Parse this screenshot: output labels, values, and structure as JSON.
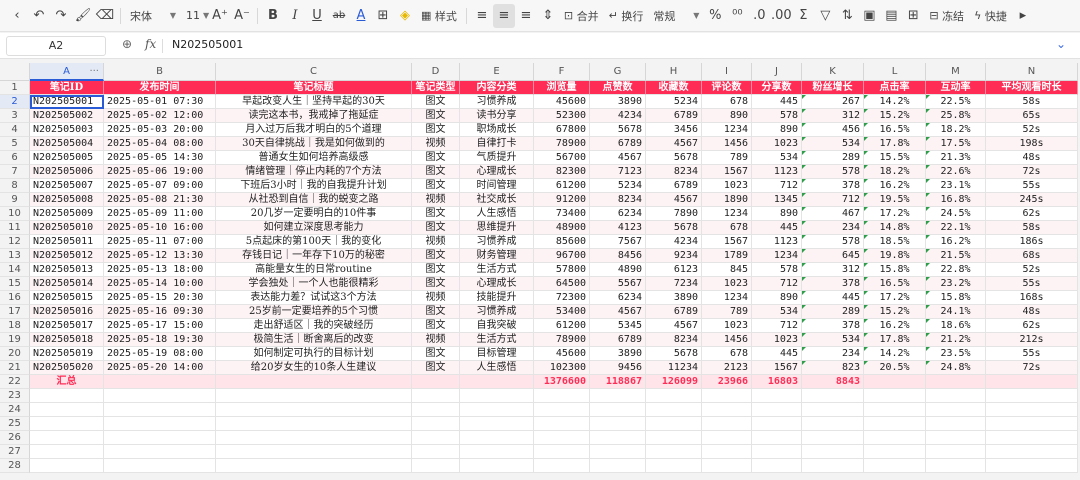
{
  "toolbar": {
    "font_name": "宋体",
    "font_size": "11",
    "bold": "B",
    "italic": "I",
    "underline": "U",
    "strike": "ab",
    "font_color": "A",
    "grow_font": "A⁺",
    "shrink_font": "A⁻",
    "style_label": "样式",
    "merge_label": "合并",
    "wrap_label": "换行",
    "number_format": "常规",
    "freeze_label": "冻结",
    "quick_label": "快捷"
  },
  "formula_bar": {
    "cell_ref": "A2",
    "fx": "fx",
    "value": "N202505001"
  },
  "columns": [
    "A",
    "B",
    "C",
    "D",
    "E",
    "F",
    "G",
    "H",
    "I",
    "J",
    "K",
    "L",
    "M",
    "N"
  ],
  "header_row": [
    "笔记ID",
    "发布时间",
    "笔记标题",
    "笔记类型",
    "内容分类",
    "浏览量",
    "点赞数",
    "收藏数",
    "评论数",
    "分享数",
    "粉丝增长",
    "点击率",
    "互动率",
    "平均观看时长"
  ],
  "rows": [
    [
      "N202505001",
      "2025-05-01 07:30",
      "早起改变人生｜坚持早起的30天",
      "图文",
      "习惯养成",
      "45600",
      "3890",
      "5234",
      "678",
      "445",
      "267",
      "14.2%",
      "22.5%",
      "58s"
    ],
    [
      "N202505002",
      "2025-05-02 12:00",
      "读完这本书，我戒掉了拖延症",
      "图文",
      "读书分享",
      "52300",
      "4234",
      "6789",
      "890",
      "578",
      "312",
      "15.2%",
      "25.8%",
      "65s"
    ],
    [
      "N202505003",
      "2025-05-03 20:00",
      "月入过万后我才明白的5个道理",
      "图文",
      "职场成长",
      "67800",
      "5678",
      "3456",
      "1234",
      "890",
      "456",
      "16.5%",
      "18.2%",
      "52s"
    ],
    [
      "N202505004",
      "2025-05-04 08:00",
      "30天自律挑战｜我是如何做到的",
      "视频",
      "自律打卡",
      "78900",
      "6789",
      "4567",
      "1456",
      "1023",
      "534",
      "17.8%",
      "17.5%",
      "198s"
    ],
    [
      "N202505005",
      "2025-05-05 14:30",
      "普通女生如何培养高级感",
      "图文",
      "气质提升",
      "56700",
      "4567",
      "5678",
      "789",
      "534",
      "289",
      "15.5%",
      "21.3%",
      "48s"
    ],
    [
      "N202505006",
      "2025-05-06 19:00",
      "情绪管理｜停止内耗的7个方法",
      "图文",
      "心理成长",
      "82300",
      "7123",
      "8234",
      "1567",
      "1123",
      "578",
      "18.2%",
      "22.6%",
      "72s"
    ],
    [
      "N202505007",
      "2025-05-07 09:00",
      "下班后3小时｜我的自我提升计划",
      "图文",
      "时间管理",
      "61200",
      "5234",
      "6789",
      "1023",
      "712",
      "378",
      "16.2%",
      "23.1%",
      "55s"
    ],
    [
      "N202505008",
      "2025-05-08 21:30",
      "从社恐到自信｜我的蜕变之路",
      "视频",
      "社交成长",
      "91200",
      "8234",
      "4567",
      "1890",
      "1345",
      "712",
      "19.5%",
      "16.8%",
      "245s"
    ],
    [
      "N202505009",
      "2025-05-09 11:00",
      "20几岁一定要明白的10件事",
      "图文",
      "人生感悟",
      "73400",
      "6234",
      "7890",
      "1234",
      "890",
      "467",
      "17.2%",
      "24.5%",
      "62s"
    ],
    [
      "N202505010",
      "2025-05-10 16:00",
      "如何建立深度思考能力",
      "图文",
      "思维提升",
      "48900",
      "4123",
      "5678",
      "678",
      "445",
      "234",
      "14.8%",
      "22.1%",
      "58s"
    ],
    [
      "N202505011",
      "2025-05-11 07:00",
      "5点起床的第100天｜我的变化",
      "视频",
      "习惯养成",
      "85600",
      "7567",
      "4234",
      "1567",
      "1123",
      "578",
      "18.5%",
      "16.2%",
      "186s"
    ],
    [
      "N202505012",
      "2025-05-12 13:30",
      "存钱日记｜一年存下10万的秘密",
      "图文",
      "财务管理",
      "96700",
      "8456",
      "9234",
      "1789",
      "1234",
      "645",
      "19.8%",
      "21.5%",
      "68s"
    ],
    [
      "N202505013",
      "2025-05-13 18:00",
      "高能量女生的日常routine",
      "图文",
      "生活方式",
      "57800",
      "4890",
      "6123",
      "845",
      "578",
      "312",
      "15.8%",
      "22.8%",
      "52s"
    ],
    [
      "N202505014",
      "2025-05-14 10:00",
      "学会独处｜一个人也能很精彩",
      "图文",
      "心理成长",
      "64500",
      "5567",
      "7234",
      "1023",
      "712",
      "378",
      "16.5%",
      "23.2%",
      "55s"
    ],
    [
      "N202505015",
      "2025-05-15 20:30",
      "表达能力差？试试这3个方法",
      "视频",
      "技能提升",
      "72300",
      "6234",
      "3890",
      "1234",
      "890",
      "445",
      "17.2%",
      "15.8%",
      "168s"
    ],
    [
      "N202505016",
      "2025-05-16 09:30",
      "25岁前一定要培养的5个习惯",
      "图文",
      "习惯养成",
      "53400",
      "4567",
      "6789",
      "789",
      "534",
      "289",
      "15.2%",
      "24.1%",
      "48s"
    ],
    [
      "N202505017",
      "2025-05-17 15:00",
      "走出舒适区｜我的突破经历",
      "图文",
      "自我突破",
      "61200",
      "5345",
      "4567",
      "1023",
      "712",
      "378",
      "16.2%",
      "18.6%",
      "62s"
    ],
    [
      "N202505018",
      "2025-05-18 19:30",
      "极简生活｜断舍离后的改变",
      "视频",
      "生活方式",
      "78900",
      "6789",
      "8234",
      "1456",
      "1023",
      "534",
      "17.8%",
      "21.2%",
      "212s"
    ],
    [
      "N202505019",
      "2025-05-19 08:00",
      "如何制定可执行的目标计划",
      "图文",
      "目标管理",
      "45600",
      "3890",
      "5678",
      "678",
      "445",
      "234",
      "14.2%",
      "23.5%",
      "55s"
    ],
    [
      "N202505020",
      "2025-05-20 14:00",
      "给20岁女生的10条人生建议",
      "图文",
      "人生感悟",
      "102300",
      "9456",
      "11234",
      "2123",
      "1567",
      "823",
      "20.5%",
      "24.8%",
      "72s"
    ]
  ],
  "summary_row": [
    "汇总",
    "",
    "",
    "",
    "",
    "1376600",
    "118867",
    "126099",
    "23966",
    "16803",
    "8843",
    "",
    "",
    ""
  ],
  "row_numbers": [
    "1",
    "2",
    "3",
    "4",
    "5",
    "6",
    "7",
    "8",
    "9",
    "10",
    "11",
    "12",
    "13",
    "14",
    "15",
    "16",
    "17",
    "18",
    "19",
    "20",
    "21",
    "22",
    "23",
    "24",
    "25",
    "26",
    "27",
    "28"
  ],
  "colors": {
    "header_bg": "#ff2d55",
    "summary_bg": "#ffe4ea",
    "summary_text": "#ff2d55",
    "selection": "#2a5bd7"
  }
}
